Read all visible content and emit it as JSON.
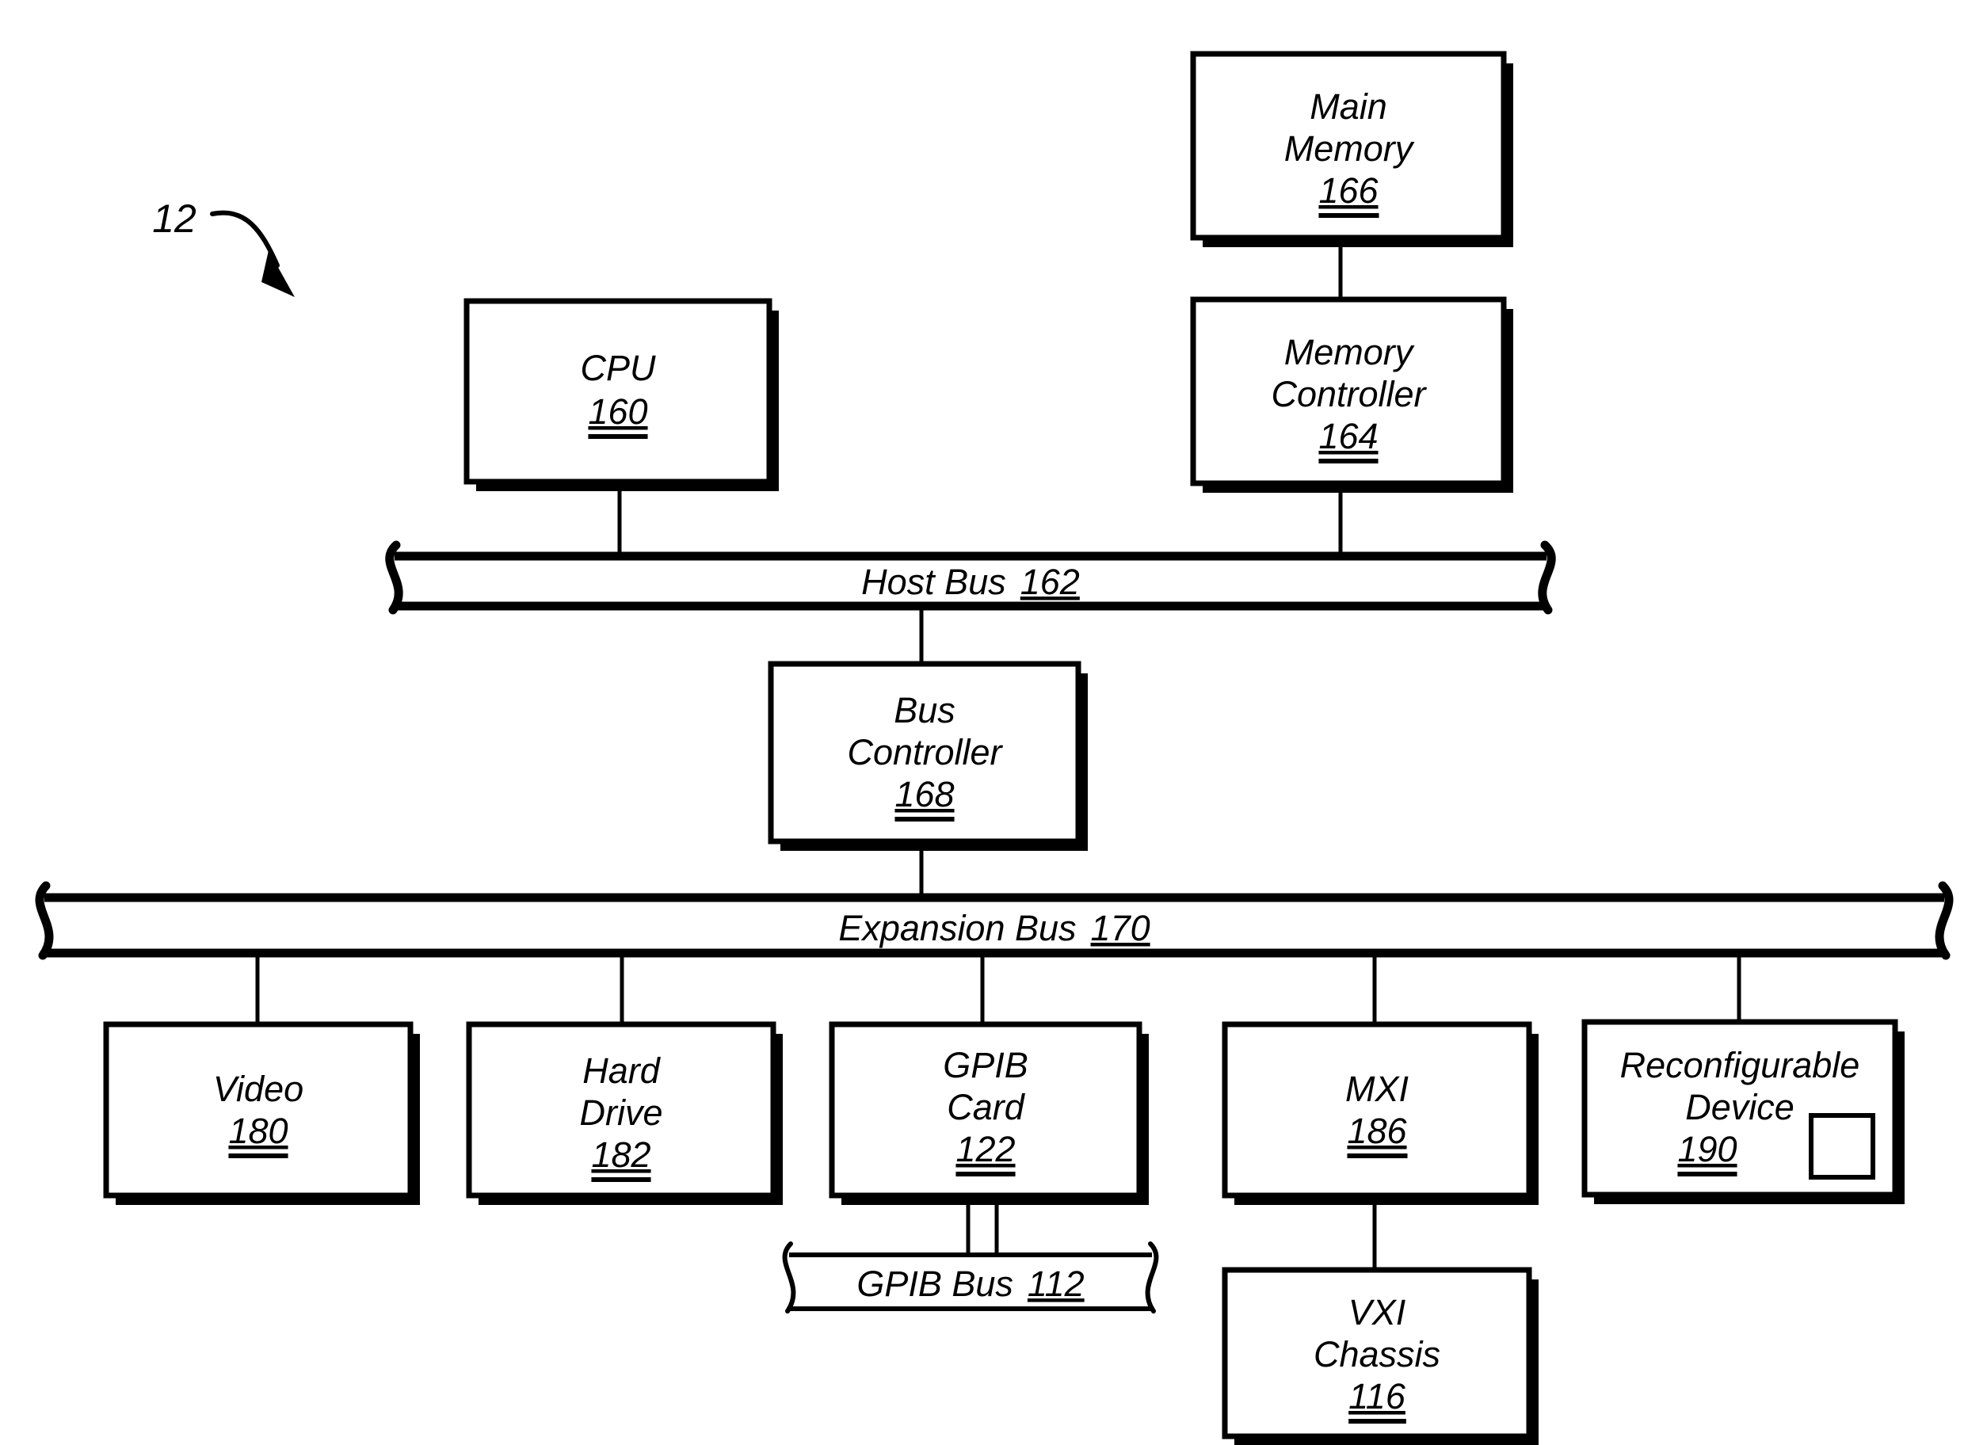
{
  "figure": {
    "tag": "12",
    "kind": "patent-block-diagram",
    "ink_color": "#000000",
    "background_color": "#ffffff"
  },
  "nodes": {
    "main_memory": {
      "line1": "Main",
      "line2": "Memory",
      "ref": "166"
    },
    "memory_controller": {
      "line1": "Memory",
      "line2": "Controller",
      "ref": "164"
    },
    "cpu": {
      "line1": "CPU",
      "line2": "",
      "ref": "160"
    },
    "bus_controller": {
      "line1": "Bus",
      "line2": "Controller",
      "ref": "168"
    },
    "video": {
      "line1": "Video",
      "line2": "",
      "ref": "180"
    },
    "hard_drive": {
      "line1": "Hard",
      "line2": "Drive",
      "ref": "182"
    },
    "gpib_card": {
      "line1": "GPIB",
      "line2": "Card",
      "ref": "122"
    },
    "mxi": {
      "line1": "MXI",
      "line2": "",
      "ref": "186"
    },
    "reconfigurable": {
      "line1": "Reconfigurable",
      "line2": "Device",
      "ref": "190"
    },
    "vxi_chassis": {
      "line1": "VXI",
      "line2": "Chassis",
      "ref": "116"
    }
  },
  "buses": {
    "host": {
      "label": "Host Bus",
      "ref": "162"
    },
    "expansion": {
      "label": "Expansion Bus",
      "ref": "170"
    },
    "gpib": {
      "label": "GPIB Bus",
      "ref": "112"
    }
  }
}
